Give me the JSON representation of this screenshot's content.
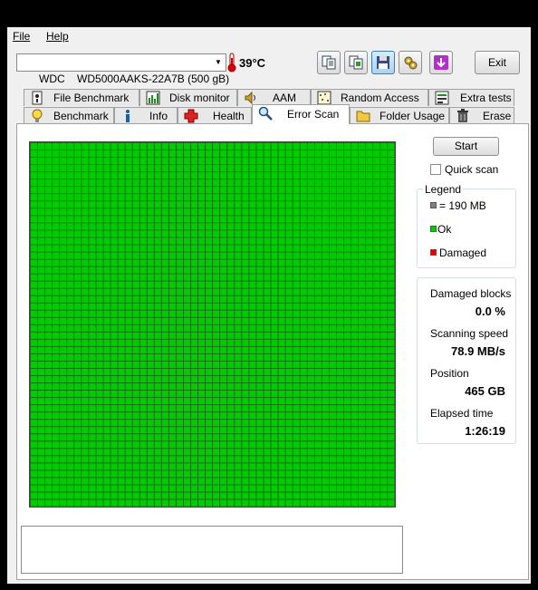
{
  "menu": {
    "file": "File",
    "help": "Help"
  },
  "toolbar": {
    "drive_vendor": "WDC",
    "drive_model": "WD5000AAKS-22A7B (500 gB)",
    "temperature": "39°C",
    "exit_label": "Exit",
    "buttons": [
      "copy-text-icon",
      "copy-screenshot-icon",
      "save-icon",
      "options-icon",
      "download-icon"
    ]
  },
  "tabs_top": [
    "File Benchmark",
    "Disk monitor",
    "AAM",
    "Random Access",
    "Extra tests"
  ],
  "tabs_bottom": [
    "Benchmark",
    "Info",
    "Health",
    "Error Scan",
    "Folder Usage",
    "Erase"
  ],
  "active_tab": "Error Scan",
  "scan": {
    "start_label": "Start",
    "quick_scan_label": "Quick scan",
    "quick_scan_checked": false
  },
  "legend": {
    "title": "Legend",
    "block_size": "= 190 MB",
    "ok": "Ok",
    "damaged": "Damaged",
    "colors": {
      "block": "#808080",
      "ok": "#00cc00",
      "damaged": "#e00000"
    }
  },
  "stats": {
    "damaged_blocks_label": "Damaged blocks",
    "damaged_blocks_value": "0.0 %",
    "speed_label": "Scanning speed",
    "speed_value": "78.9 MB/s",
    "position_label": "Position",
    "position_value": "465 GB",
    "elapsed_label": "Elapsed time",
    "elapsed_value": "1:26:19"
  },
  "colors": {
    "ok_block": "#00cc00",
    "grid_line": "#1a6e1a"
  }
}
